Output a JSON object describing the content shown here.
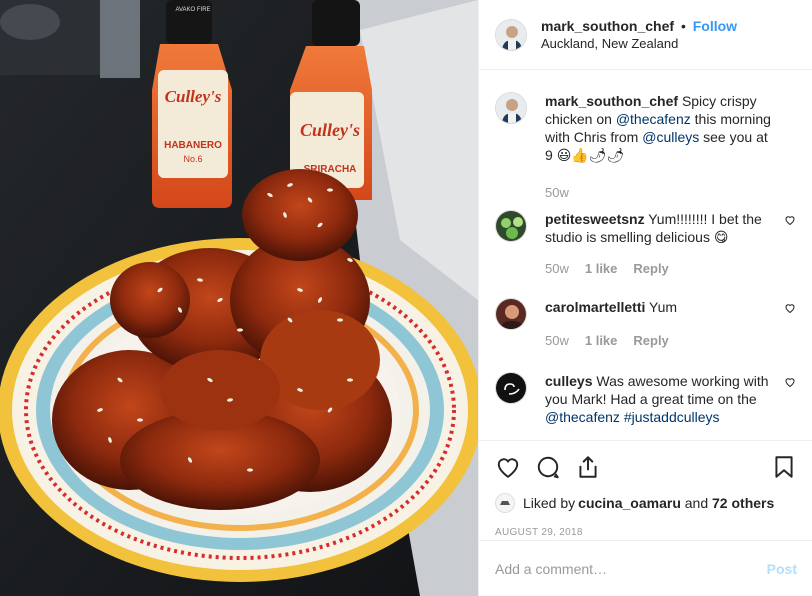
{
  "header": {
    "username": "mark_southon_chef",
    "separator": "•",
    "follow_label": "Follow",
    "location": "Auckland, New Zealand"
  },
  "caption": {
    "username": "mark_southon_chef",
    "text_before": "Spicy crispy chicken on ",
    "mention1": "@thecafenz",
    "text_mid": " this morning with Chris from ",
    "mention2": "@culleys",
    "text_after": " see you at 9 ",
    "emojis": "😃👍🌶🌶",
    "time": "50w"
  },
  "comments": [
    {
      "username": "petitesweetsnz",
      "text": "Yum!!!!!!!! I bet the studio is smelling delicious 😋",
      "time": "50w",
      "likes": "1 like",
      "reply": "Reply"
    },
    {
      "username": "carolmartelletti",
      "text": "Yum",
      "time": "50w",
      "likes": "1 like",
      "reply": "Reply"
    },
    {
      "username": "culleys",
      "text_before": "Was awesome working with you Mark! Had a great time on the ",
      "mention": "@thecafenz",
      "hashtag": "#justaddculleys"
    }
  ],
  "likes": {
    "prefix": "Liked by ",
    "user": "cucina_oamaru",
    "suffix": " and ",
    "others": "72 others"
  },
  "date": "AUGUST 29, 2018",
  "add_comment": {
    "placeholder": "Add a comment…",
    "post_label": "Post"
  },
  "photo": {
    "bottle1": {
      "brand": "Culley's",
      "flavor": "HABANERO",
      "number": "No.6",
      "label_top": "AVAKO FIRE"
    },
    "bottle2": {
      "brand": "Culley's",
      "flavor": "SRIRACHA"
    }
  },
  "colors": {
    "accent": "#3897f0",
    "link": "#003569",
    "muted": "#999999",
    "post_disabled": "#b2dffc"
  },
  "icons": [
    "heart-icon",
    "comment-icon",
    "share-icon",
    "bookmark-icon"
  ]
}
